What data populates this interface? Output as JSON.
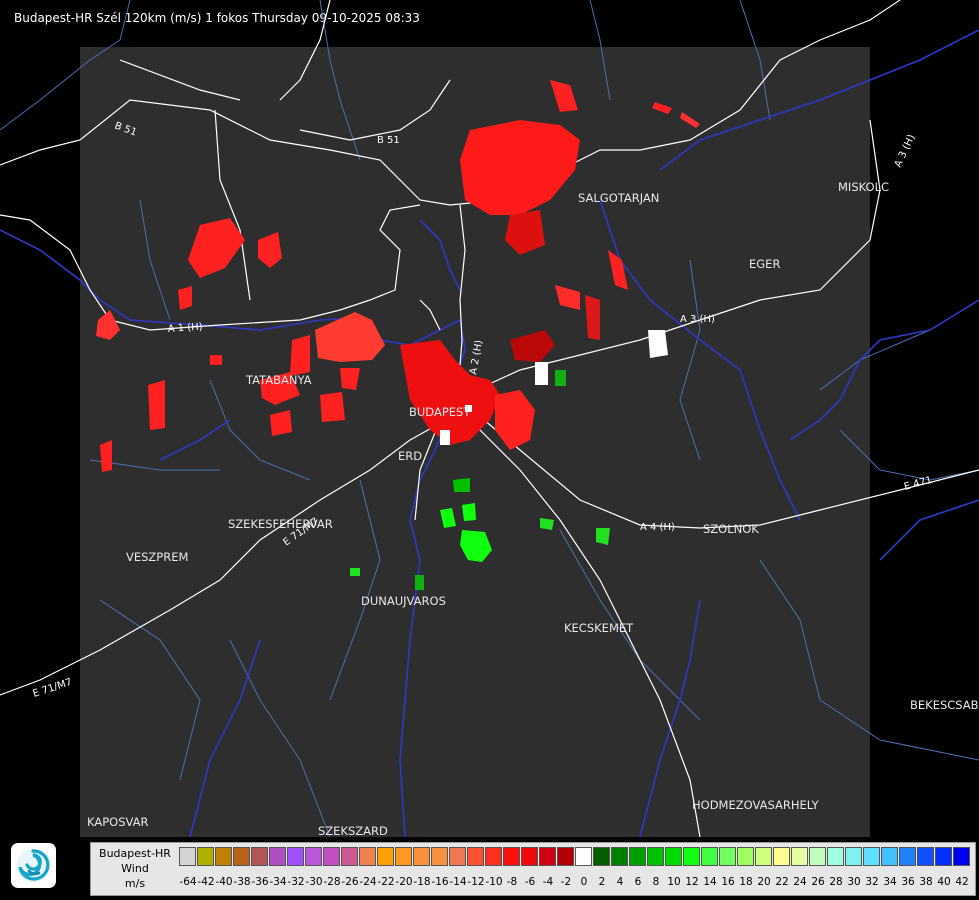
{
  "header": {
    "title": "Budapest-HR Szél 120km (m/s) 1 fokos Thursday 09-10-2025 08:33"
  },
  "map": {
    "cities": [
      "SALGOTARJAN",
      "MISKOLC",
      "EGER",
      "TATABANYA",
      "BUDAPEST",
      "ERD",
      "SZEKESFEHERVAR",
      "VESZPREM",
      "DUNAUJVAROS",
      "KECSKEMET",
      "SZOLNOK",
      "BEKESCSABA",
      "HODMEZOVASARHELY",
      "KAPOSVAR",
      "SZEKSZARD"
    ],
    "roads": [
      "B 51",
      "B 51",
      "A 3 (H)",
      "A 3 (H)",
      "A 1 (H)",
      "A 2 (H)",
      "A 4 (H)",
      "E 71/M7",
      "E 71/M7",
      "E 471"
    ],
    "colors": {
      "background": "#000000",
      "radar_area": "#2e2e2e",
      "borders": "#ffffff",
      "rivers": "#2c39c8",
      "counties": "#4a6fb5"
    }
  },
  "legend": {
    "label_lines": [
      "Budapest-HR",
      "Wind",
      "m/s"
    ],
    "ticks": [
      "-64",
      "-42",
      "-40",
      "-38",
      "-36",
      "-34",
      "-32",
      "-30",
      "-28",
      "-26",
      "-24",
      "-22",
      "-20",
      "-18",
      "-16",
      "-14",
      "-12",
      "-10",
      "-8",
      "-6",
      "-4",
      "-2",
      "0",
      "2",
      "4",
      "6",
      "8",
      "10",
      "12",
      "14",
      "16",
      "18",
      "20",
      "22",
      "24",
      "26",
      "28",
      "30",
      "32",
      "34",
      "36",
      "38",
      "40",
      "42"
    ],
    "colors": [
      "#d4d4d4",
      "#b0b000",
      "#c08000",
      "#b86418",
      "#b05858",
      "#b050c0",
      "#a050ff",
      "#b858d8",
      "#c050c0",
      "#d05890",
      "#f08050",
      "#ffa000",
      "#ff9820",
      "#f89040",
      "#f89040",
      "#f07850",
      "#ff5030",
      "#ff3020",
      "#ff1010",
      "#ee0a0a",
      "#d00010",
      "#b00000",
      "#ffffff",
      "#006000",
      "#008000",
      "#00a000",
      "#00c000",
      "#00dc00",
      "#10ff10",
      "#40ff40",
      "#70ff60",
      "#a0ff60",
      "#d0ff80",
      "#ffff90",
      "#e8ffa0",
      "#c0ffc0",
      "#a0ffe0",
      "#80f0f0",
      "#60e0ff",
      "#40c0ff",
      "#2080ff",
      "#1050ff",
      "#0030ff",
      "#0000f0"
    ]
  }
}
